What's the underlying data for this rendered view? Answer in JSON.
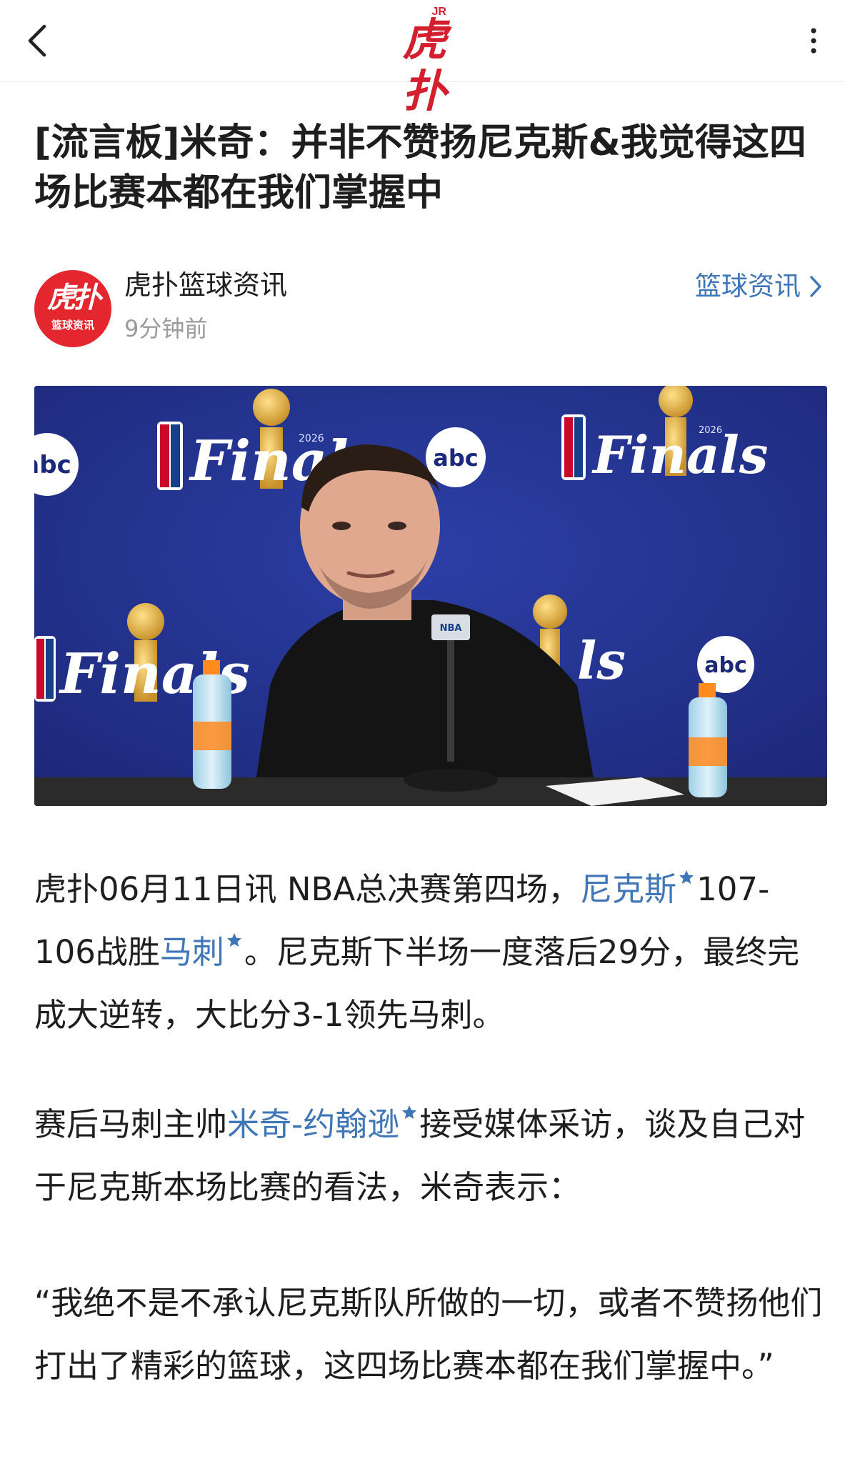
{
  "app": {
    "logo_text": "虎扑",
    "logo_badge": "JR"
  },
  "article": {
    "title": "[流言板]米奇：并非不赞扬尼克斯&我觉得这四场比赛本都在我们掌握中",
    "author": {
      "name": "虎扑篮球资讯",
      "avatar_top": "虎扑",
      "avatar_bottom": "篮球资讯",
      "time_ago": "9分钟前"
    },
    "category_link": "篮球资讯",
    "hero_image": {
      "backdrop_text_finals": "Finals",
      "backdrop_text_year": "2026",
      "backdrop_text_sponsor": "abc",
      "backdrop_text_nba": "NBA"
    },
    "paragraphs": {
      "p1": {
        "before_tag1": "虎扑06月11日讯 NBA总决赛第四场，",
        "tag1": "尼克斯",
        "between": "107-106战胜",
        "tag2": "马刺",
        "after": "。尼克斯下半场一度落后29分，最终完成大逆转，大比分3-1领先马刺。"
      },
      "p2": {
        "before_tag": "赛后马刺主帅",
        "tag": "米奇-约翰逊",
        "after": "接受媒体采访，谈及自己对于尼克斯本场比赛的看法，米奇表示："
      },
      "p3": {
        "text": "“我绝不是不承认尼克斯队所做的一切，或者不赞扬他们打出了精彩的篮球，这四场比赛本都在我们掌握中。”"
      }
    }
  },
  "colors": {
    "brand_red": "#d2202f",
    "link_blue": "#3f76b8",
    "text": "#1e1e1e",
    "muted": "#9b9b9b",
    "backdrop_blue": "#22308a"
  },
  "icons": {
    "back": "back-chevron-icon",
    "more": "more-vertical-icon",
    "category_arrow": "chevron-right-icon",
    "tag_star": "star-icon"
  }
}
